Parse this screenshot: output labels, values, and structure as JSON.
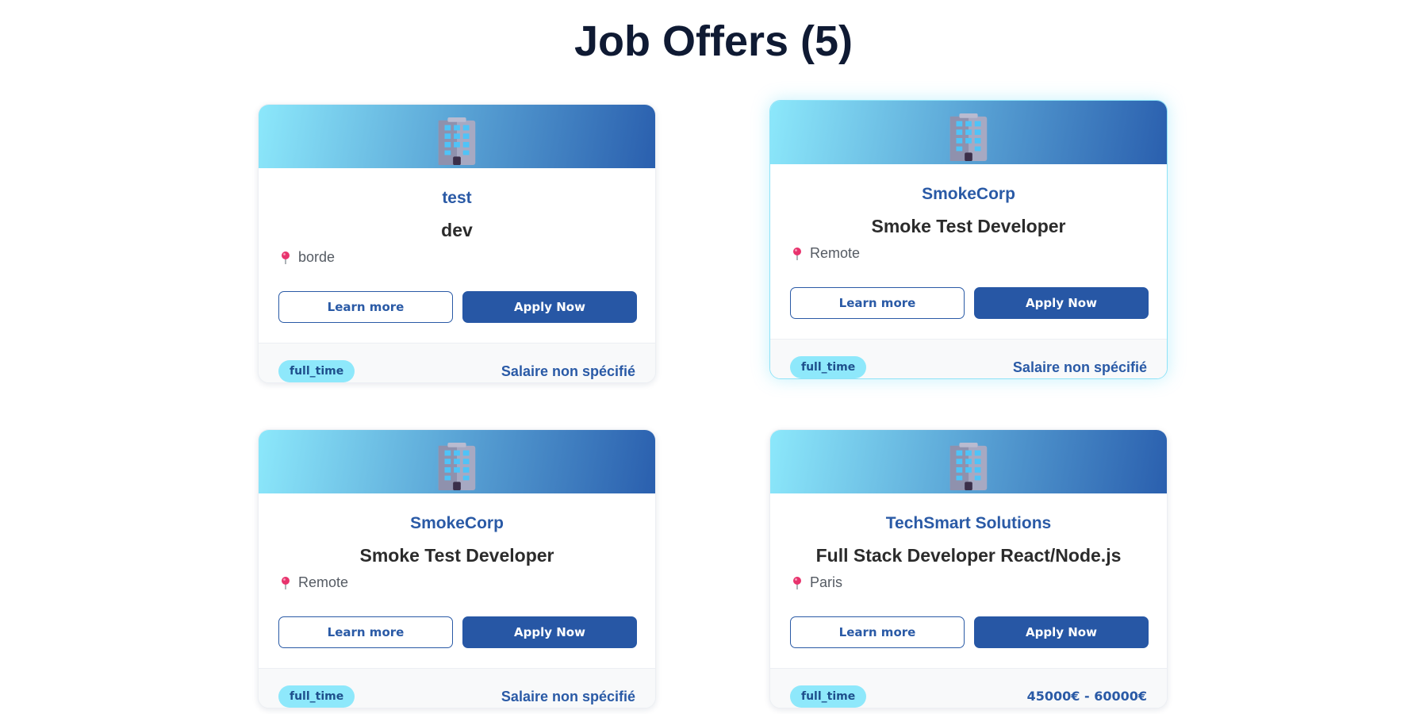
{
  "page": {
    "title": "Job Offers (5)"
  },
  "jobs": [
    {
      "company": "test",
      "title": "dev",
      "location": "borde",
      "learn_more_label": "Learn more",
      "apply_label": "Apply Now",
      "contract_type": "full_time",
      "salary": "Salaire non spécifié"
    },
    {
      "company": "SmokeCorp",
      "title": "Smoke Test Developer",
      "location": "Remote",
      "learn_more_label": "Learn more",
      "apply_label": "Apply Now",
      "contract_type": "full_time",
      "salary": "Salaire non spécifié"
    },
    {
      "company": "SmokeCorp",
      "title": "Smoke Test Developer",
      "location": "Remote",
      "learn_more_label": "Learn more",
      "apply_label": "Apply Now",
      "contract_type": "full_time",
      "salary": "Salaire non spécifié"
    },
    {
      "company": "TechSmart Solutions",
      "title": "Full Stack Developer React/Node.js",
      "location": "Paris",
      "learn_more_label": "Learn more",
      "apply_label": "Apply Now",
      "contract_type": "full_time",
      "salary": "45000€ - 60000€"
    }
  ],
  "icons": {
    "banner": "office-building-icon",
    "location": "round-pushpin-icon"
  },
  "colors": {
    "primary": "#2757a5",
    "accent": "#8ee8fb",
    "heading": "#0f1a33"
  }
}
